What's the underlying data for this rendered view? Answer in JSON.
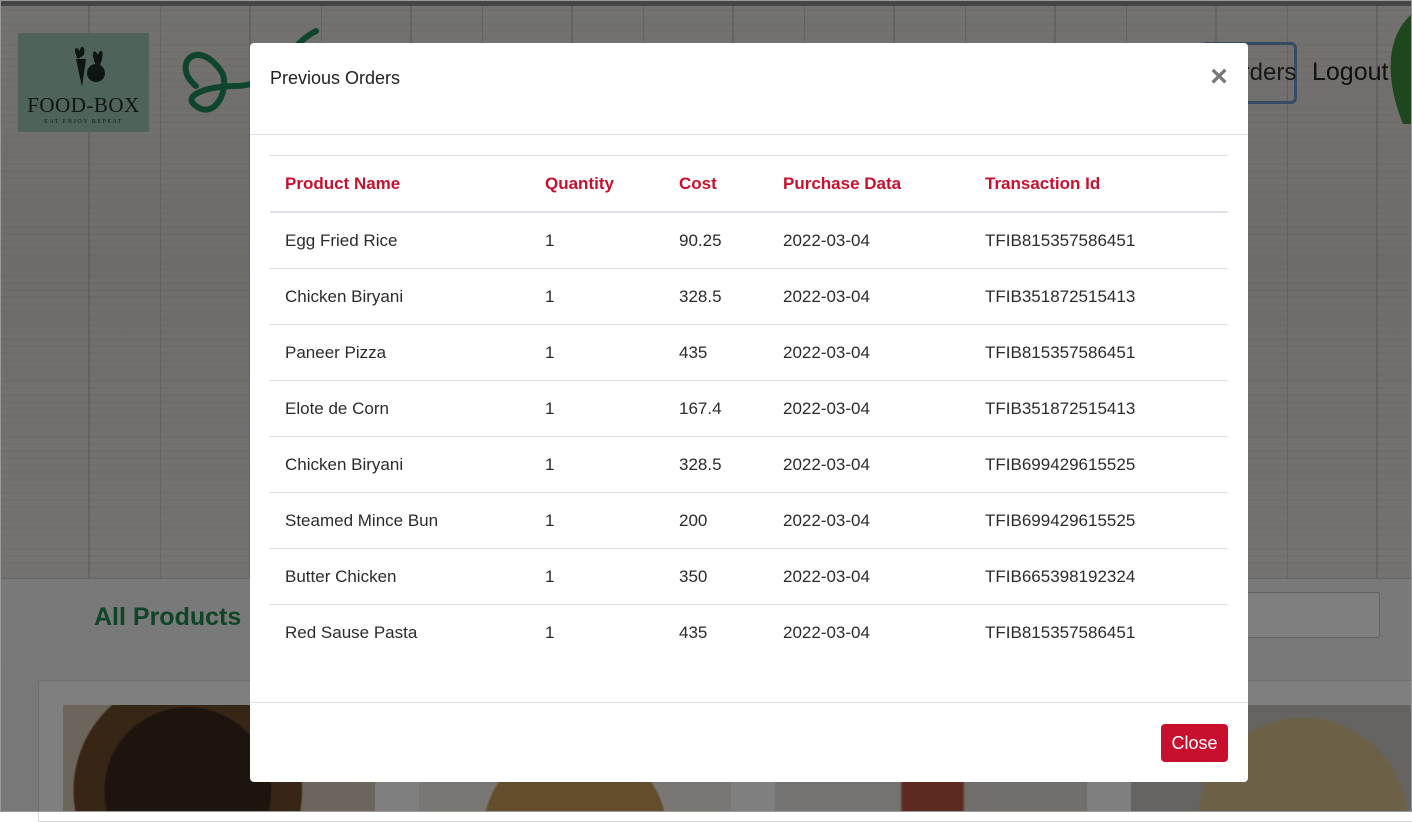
{
  "header": {
    "logo_text": "FOOD-BOX",
    "logo_tagline": "EAT ENJOY REPEAT",
    "orders_link": "Orders",
    "logout_link": "Logout"
  },
  "products": {
    "section_title": "All Products"
  },
  "modal": {
    "title": "Previous Orders",
    "close_icon": "×",
    "close_button": "Close",
    "columns": [
      "Product Name",
      "Quantity",
      "Cost",
      "Purchase Data",
      "Transaction Id"
    ],
    "rows": [
      [
        "Egg Fried Rice",
        "1",
        "90.25",
        "2022-03-04",
        "TFIB815357586451"
      ],
      [
        "Chicken Biryani",
        "1",
        "328.5",
        "2022-03-04",
        "TFIB351872515413"
      ],
      [
        "Paneer Pizza",
        "1",
        "435",
        "2022-03-04",
        "TFIB815357586451"
      ],
      [
        "Elote de Corn",
        "1",
        "167.4",
        "2022-03-04",
        "TFIB351872515413"
      ],
      [
        "Chicken Biryani",
        "1",
        "328.5",
        "2022-03-04",
        "TFIB699429615525"
      ],
      [
        "Steamed Mince Bun",
        "1",
        "200",
        "2022-03-04",
        "TFIB699429615525"
      ],
      [
        "Butter Chicken",
        "1",
        "350",
        "2022-03-04",
        "TFIB665398192324"
      ],
      [
        "Red Sause Pasta",
        "1",
        "435",
        "2022-03-04",
        "TFIB815357586451"
      ]
    ]
  },
  "colors": {
    "accent_red": "#c8102e",
    "brand_green": "#1f8a4c"
  }
}
